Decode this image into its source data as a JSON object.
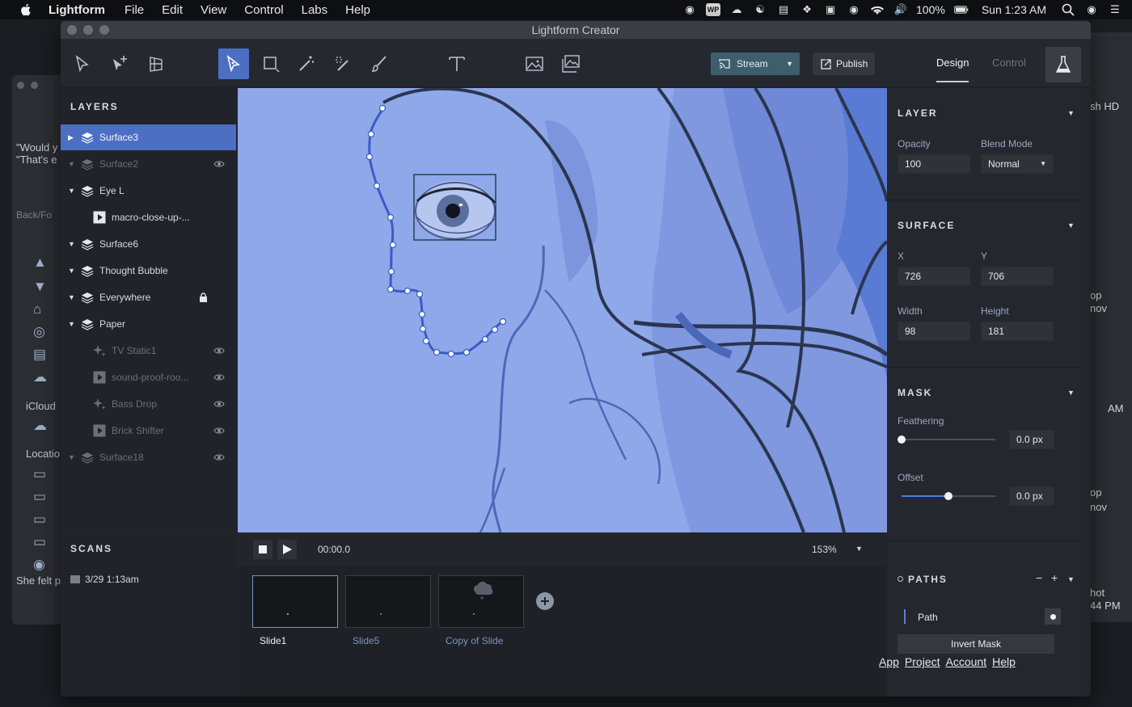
{
  "menubar": {
    "app_name": "Lightform",
    "menus": [
      "File",
      "Edit",
      "View",
      "Control",
      "Labs",
      "Help"
    ],
    "battery": "100%",
    "clock": "Sun 1:23 AM"
  },
  "background_windows": {
    "left_texts": [
      "\"Would y",
      "\"That's e",
      "Back/Fo",
      "iCloud",
      "Locatio",
      "She felt p"
    ],
    "right_texts": [
      "sh HD",
      "op",
      "nov",
      "AM",
      "op",
      "nov",
      "hot",
      "44 PM"
    ]
  },
  "window": {
    "title": "Lightform Creator"
  },
  "toolbar": {
    "stream_label": "Stream",
    "publish_label": "Publish",
    "tabs": {
      "design": "Design",
      "control": "Control"
    }
  },
  "layers": {
    "heading": "LAYERS",
    "items": [
      {
        "name": "Surface3",
        "kind": "surface"
      },
      {
        "name": "Surface2",
        "kind": "surface"
      },
      {
        "name": "Eye L",
        "kind": "surface"
      },
      {
        "name": "macro-close-up-...",
        "kind": "video"
      },
      {
        "name": "Surface6",
        "kind": "surface"
      },
      {
        "name": "Thought Bubble",
        "kind": "surface"
      },
      {
        "name": "Everywhere",
        "kind": "surface"
      },
      {
        "name": "Paper",
        "kind": "surface"
      },
      {
        "name": "TV Static1",
        "kind": "effect"
      },
      {
        "name": "sound-proof-roo...",
        "kind": "video"
      },
      {
        "name": "Bass Drop",
        "kind": "effect"
      },
      {
        "name": "Brick Shifter",
        "kind": "video"
      },
      {
        "name": "Surface18",
        "kind": "surface"
      }
    ]
  },
  "scans": {
    "heading": "SCANS",
    "items": [
      {
        "label": "3/29 1:13am"
      }
    ]
  },
  "timeline": {
    "time": "00:00.0",
    "zoom": "153%",
    "slides": [
      {
        "label": "Slide1"
      },
      {
        "label": "Slide5"
      },
      {
        "label": "Copy of Slide"
      }
    ]
  },
  "properties": {
    "layer": {
      "title": "LAYER",
      "opacity_label": "Opacity",
      "opacity_value": "100",
      "blend_label": "Blend Mode",
      "blend_value": "Normal"
    },
    "surface": {
      "title": "SURFACE",
      "x_label": "X",
      "x_value": "726",
      "y_label": "Y",
      "y_value": "706",
      "width_label": "Width",
      "width_value": "98",
      "height_label": "Height",
      "height_value": "181"
    },
    "mask": {
      "title": "MASK",
      "feathering_label": "Feathering",
      "feathering_value": "0.0 px",
      "feathering_fraction": 0.0,
      "offset_label": "Offset",
      "offset_value": "0.0 px",
      "offset_fraction": 0.5
    },
    "paths": {
      "title": "PATHS",
      "path_label": "Path",
      "invert_label": "Invert Mask"
    }
  },
  "footer": {
    "links": [
      "App",
      "Project",
      "Account",
      "Help"
    ]
  },
  "colors": {
    "accent": "#4c6fc4",
    "canvas_bg": "#8fa8ea",
    "stream_button": "#3d5e6d"
  }
}
